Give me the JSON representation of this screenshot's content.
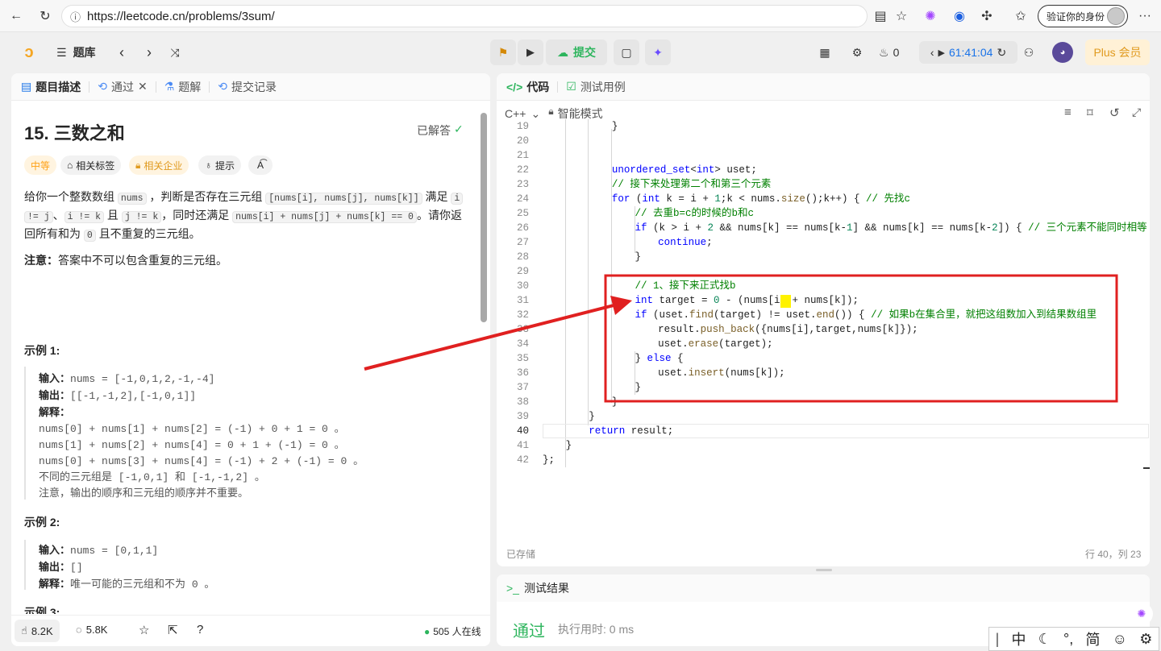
{
  "browser": {
    "url": "https://leetcode.cn/problems/3sum/",
    "verify_label": "验证你的身份",
    "more": "···"
  },
  "toolbar": {
    "logo": "LeetCode",
    "problem_bank": "题库",
    "submit_label": "提交",
    "streak": "0",
    "timer": "61:41:04",
    "plus": "Plus 会员"
  },
  "left_tabs": {
    "description": "题目描述",
    "passed": "通过",
    "solution": "题解",
    "submissions": "提交记录"
  },
  "problem": {
    "title": "15. 三数之和",
    "solved": "已解答",
    "difficulty": "中等",
    "tags": [
      "相关标签",
      "相关企业",
      "提示"
    ],
    "desc_1": "给你一个整数数组",
    "code_nums": "nums",
    "desc_2": "，判断是否存在三元组",
    "code_triplet": "[nums[i], nums[j], nums[k]]",
    "desc_3": "满足",
    "code_i": "i",
    "code_ineqj": "!= j",
    "desc_4": "、",
    "code_ineqk": "i != k",
    "desc_5": "且",
    "code_jneqk": "j != k",
    "desc_6": "，同时还满足",
    "code_sum": "nums[i] + nums[j] + nums[k] == 0",
    "desc_7": "。请你",
    "desc_8": "返回所有和为",
    "code_zero": "0",
    "desc_9": "且不重复的三元组。",
    "note_label": "注意：",
    "note_text": "答案中不可以包含重复的三元组。",
    "ex1_title": "示例 1:",
    "ex1_in_label": "输入：",
    "ex1_in": "nums = [-1,0,1,2,-1,-4]",
    "ex1_out_label": "输出：",
    "ex1_out": "[[-1,-1,2],[-1,0,1]]",
    "ex1_exp_label": "解释：",
    "ex1_l1": "nums[0] + nums[1] + nums[2] = (-1) + 0 + 1 = 0 。",
    "ex1_l2": "nums[1] + nums[2] + nums[4] = 0 + 1 + (-1) = 0 。",
    "ex1_l3": "nums[0] + nums[3] + nums[4] = (-1) + 2 + (-1) = 0 。",
    "ex1_l4": "不同的三元组是 [-1,0,1] 和 [-1,-1,2] 。",
    "ex1_l5": "注意，输出的顺序和三元组的顺序并不重要。",
    "ex2_title": "示例 2:",
    "ex2_in_label": "输入：",
    "ex2_in": "nums = [0,1,1]",
    "ex2_out_label": "输出：",
    "ex2_out": "[]",
    "ex2_exp_label": "解释：",
    "ex2_exp": "唯一可能的三元组和不为 0 。",
    "ex3_title": "示例 3:"
  },
  "footer_left": {
    "likes": "8.2K",
    "comments": "5.8K",
    "online": "505 人在线"
  },
  "code_panel": {
    "tab_code": "代码",
    "tab_tests": "测试用例",
    "language": "C++",
    "mode": "智能模式",
    "saved": "已存储",
    "cursor": "行 40，列 23"
  },
  "code_lines": [
    {
      "n": "19",
      "t": "}"
    },
    {
      "n": "20",
      "t": ""
    },
    {
      "n": "21",
      "t": ""
    },
    {
      "n": "22",
      "t": "unordered_set<int> uset;"
    },
    {
      "n": "23",
      "t": "// 接下来处理第二个和第三个元素"
    },
    {
      "n": "24",
      "t": "for (int k = i + 1;k < nums.size();k++) { // 先找c"
    },
    {
      "n": "25",
      "t": "// 去重b=c的时候的b和c"
    },
    {
      "n": "26",
      "t": "if (k > i + 2 && nums[k] == nums[k-1] && nums[k] == nums[k-2]) { // 三个元素不能同时相等"
    },
    {
      "n": "27",
      "t": "continue;"
    },
    {
      "n": "28",
      "t": "}"
    },
    {
      "n": "29",
      "t": ""
    },
    {
      "n": "30",
      "t": "// 1、接下来正式找b"
    },
    {
      "n": "31",
      "t": "int target = 0 - (nums[i] + nums[k]);"
    },
    {
      "n": "32",
      "t": "if (uset.find(target) != uset.end()) { // 如果b在集合里，就把这组数加入到结果数组里"
    },
    {
      "n": "33",
      "t": "result.push_back({nums[i],target,nums[k]});"
    },
    {
      "n": "34",
      "t": "uset.erase(target);"
    },
    {
      "n": "35",
      "t": "} else {"
    },
    {
      "n": "36",
      "t": "uset.insert(nums[k]);"
    },
    {
      "n": "37",
      "t": "}"
    },
    {
      "n": "38",
      "t": "}"
    },
    {
      "n": "39",
      "t": "}"
    },
    {
      "n": "40",
      "t": "return result;"
    },
    {
      "n": "41",
      "t": "}"
    },
    {
      "n": "42",
      "t": "};"
    }
  ],
  "result_panel": {
    "title": "测试结果",
    "status": "通过",
    "runtime": "执行用时: 0 ms"
  },
  "ime": {
    "lang": "中",
    "punct": "°,",
    "simp": "简"
  },
  "colors": {
    "accent_green": "#2db55d",
    "arrow_red": "#e02020",
    "plus_bg": "#fff1d6",
    "plus_text": "#e09a1f",
    "difficulty": "#ffa116"
  }
}
